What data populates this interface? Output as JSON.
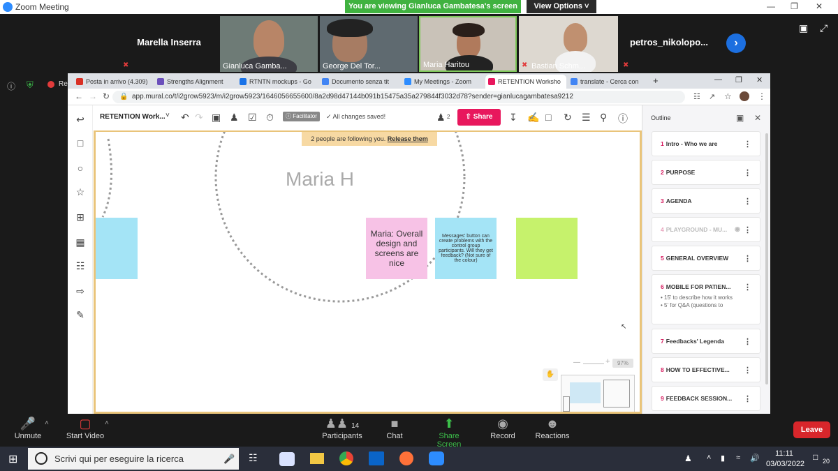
{
  "zoom": {
    "window_title": "Zoom Meeting",
    "share_banner": "You are viewing Gianluca Gambatesa's screen",
    "view_options": "View Options",
    "participants": [
      {
        "name": "Marella Inserra",
        "video": false
      },
      {
        "name": "Gianluca Gamba...",
        "video": true
      },
      {
        "name": "George Del Tor...",
        "video": true
      },
      {
        "name": "Maria Haritou",
        "video": true
      },
      {
        "name": "Bastian Schm...",
        "video": true
      },
      {
        "name": "petros_nikolopo...",
        "video": false
      }
    ],
    "recording_label": "Rec",
    "toolbar": {
      "unmute": "Unmute",
      "start_video": "Start Video",
      "participants": "Participants",
      "participants_count": "14",
      "chat": "Chat",
      "share_screen": "Share Screen",
      "record": "Record",
      "reactions": "Reactions",
      "leave": "Leave"
    }
  },
  "browser": {
    "tabs": [
      {
        "label": "Posta in arrivo (4.309)",
        "color": "#d93025"
      },
      {
        "label": "Strengths Alignment",
        "color": "#6b4fbb"
      },
      {
        "label": "RTNTN mockups - Go",
        "color": "#1a73e8"
      },
      {
        "label": "Documento senza tit",
        "color": "#4285f4"
      },
      {
        "label": "My Meetings - Zoom",
        "color": "#2d8cff"
      },
      {
        "label": "RETENTION Worksho",
        "color": "#e8175d"
      },
      {
        "label": "translate - Cerca con",
        "color": "#4285f4"
      }
    ],
    "url": "app.mural.co/t/i2grow5923/m/i2grow5923/1646056655600/8a2d98d47144b091b15475a35a279844f3032d78?sender=gianlucagambatesa9212"
  },
  "mural": {
    "board_title": "RETENTION Work...",
    "facilitator": "Facilitator",
    "save_status": "All changes saved!",
    "users_count": "2",
    "share": "Share",
    "follow_banner": "2 people are following you.",
    "release": "Release them",
    "area_label": "Maria H",
    "stickies": [
      {
        "text": "Maria: Overall design and screens are nice",
        "color": "#f7c2e6"
      },
      {
        "text": "Messages' button can create problems with the control group participants. Will they get feedback? (Not sure of the colour)",
        "color": "#a4e4f6"
      },
      {
        "text": "",
        "color": "#c6f26c"
      },
      {
        "text": "",
        "color": "#a4e4f6"
      }
    ],
    "zoom_level": "97%",
    "outline": {
      "title": "Outline",
      "items": [
        {
          "num": "1",
          "label": "Intro - Who we are"
        },
        {
          "num": "2",
          "label": "PURPOSE"
        },
        {
          "num": "3",
          "label": "AGENDA"
        },
        {
          "num": "4",
          "label": "PLAYGROUND - MU..."
        },
        {
          "num": "5",
          "label": "GENERAL OVERVIEW"
        },
        {
          "num": "6",
          "label": "MOBILE FOR PATIEN..."
        },
        {
          "num": "7",
          "label": "Feedbacks' Legenda"
        },
        {
          "num": "8",
          "label": "HOW TO EFFECTIVE..."
        },
        {
          "num": "9",
          "label": "FEEDBACK SESSION..."
        }
      ],
      "sub_bullets": [
        "15' to describe how it works",
        "5' for Q&A (questions to"
      ]
    }
  },
  "taskbar": {
    "search_placeholder": "Scrivi qui per eseguire la ricerca",
    "time": "11:11",
    "date": "03/03/2022",
    "notifications": "20"
  }
}
